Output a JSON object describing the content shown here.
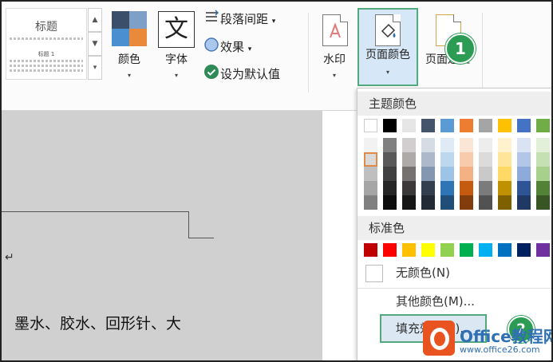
{
  "ribbon": {
    "style_gallery": {
      "heading_style": "标题",
      "sub_style": "标题 1"
    },
    "colors": {
      "label": "颜色"
    },
    "fonts": {
      "label": "字体",
      "glyph": "文"
    },
    "paragraph_spacing": {
      "label": "段落间距"
    },
    "effects": {
      "label": "效果"
    },
    "set_default": {
      "label": "设为默认值"
    },
    "watermark": {
      "label": "水印"
    },
    "page_color": {
      "label": "页面颜色"
    },
    "page_border": {
      "label": "页面边框"
    },
    "dropdown_arrow": "▾",
    "colors_palette": [
      "#3b4e6a",
      "#7d9fc8",
      "#4a90d0",
      "#e88a3a"
    ]
  },
  "dropdown": {
    "theme_colors_title": "主题颜色",
    "theme_top_row": [
      "#ffffff",
      "#000000",
      "#e7e6e6",
      "#44546a",
      "#5b9bd5",
      "#ed7d31",
      "#a5a5a5",
      "#ffc000",
      "#4472c4",
      "#70ad47"
    ],
    "theme_shades": [
      [
        "#f2f2f2",
        "#d9d9d9",
        "#bfbfbf",
        "#a6a6a6",
        "#808080"
      ],
      [
        "#808080",
        "#595959",
        "#404040",
        "#262626",
        "#0d0d0d"
      ],
      [
        "#d0cece",
        "#aeaaaa",
        "#757171",
        "#3a3838",
        "#171616"
      ],
      [
        "#d6dce4",
        "#adb9ca",
        "#8497b0",
        "#333f4f",
        "#222a35"
      ],
      [
        "#deebf6",
        "#bdd7ee",
        "#9dc3e6",
        "#2e75b5",
        "#1f4e79"
      ],
      [
        "#fbe5d5",
        "#f7cbac",
        "#f4b183",
        "#c55a11",
        "#833c0b"
      ],
      [
        "#ededed",
        "#dbdbdb",
        "#c9c9c9",
        "#7b7b7b",
        "#525252"
      ],
      [
        "#fff2cc",
        "#fee599",
        "#ffd965",
        "#bf9000",
        "#7f6000"
      ],
      [
        "#dae3f3",
        "#b4c6e7",
        "#8eaadb",
        "#2f5496",
        "#1f3864"
      ],
      [
        "#e2efd9",
        "#c5e0b3",
        "#a8d08d",
        "#538135",
        "#375623"
      ]
    ],
    "standard_colors_title": "标准色",
    "standard_colors": [
      "#c00000",
      "#ff0000",
      "#ffc000",
      "#ffff00",
      "#92d050",
      "#00b050",
      "#00b0f0",
      "#0070c0",
      "#002060",
      "#7030a0"
    ],
    "no_color": "无颜色(N)",
    "more_colors": "其他颜色(M)...",
    "fill_effects": "填充效果(F)..."
  },
  "callouts": {
    "step1": "1",
    "step2": "2"
  },
  "document": {
    "paragraph_mark": "↵",
    "body_text": "墨水、胶水、回形针、大"
  },
  "watermark_logo": {
    "name": "Office教程网",
    "url": "www.office26.com"
  }
}
